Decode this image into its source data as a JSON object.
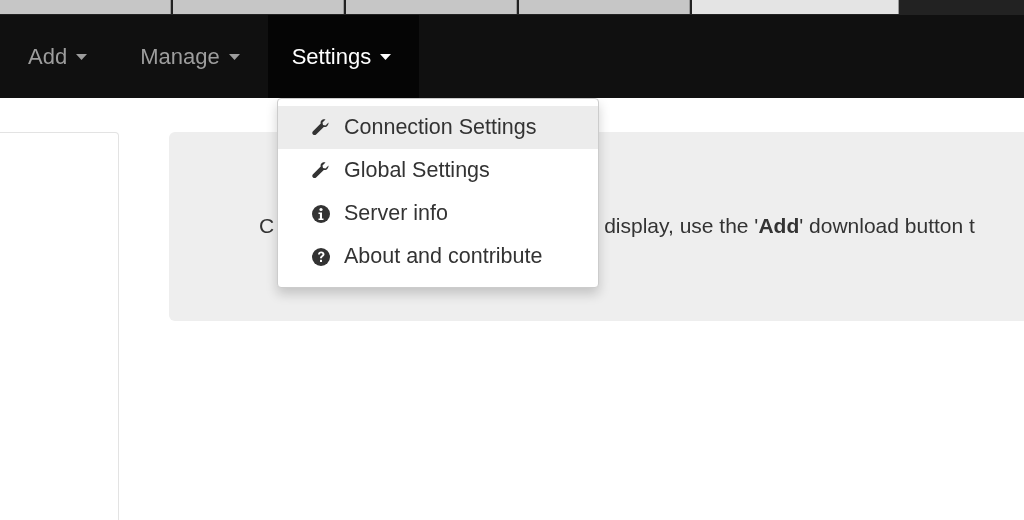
{
  "browser_tabs": [
    {
      "selected": false
    },
    {
      "selected": false
    },
    {
      "selected": false
    },
    {
      "selected": false
    },
    {
      "selected": true
    }
  ],
  "navbar": {
    "items": [
      {
        "label": "Add",
        "selected": false
      },
      {
        "label": "Manage",
        "selected": false
      },
      {
        "label": "Settings",
        "selected": true
      }
    ]
  },
  "dropdown": {
    "items": [
      {
        "label": "Connection Settings",
        "kind": "wrench",
        "selected": true
      },
      {
        "label": "Global Settings",
        "kind": "wrench",
        "selected": false
      },
      {
        "label": "Server info",
        "kind": "info",
        "selected": false
      },
      {
        "label": "About and contribute",
        "kind": "question",
        "selected": false
      }
    ]
  },
  "jumbotron": {
    "text_start": "C",
    "text_end": "display, use the '**Add**' download button t"
  }
}
